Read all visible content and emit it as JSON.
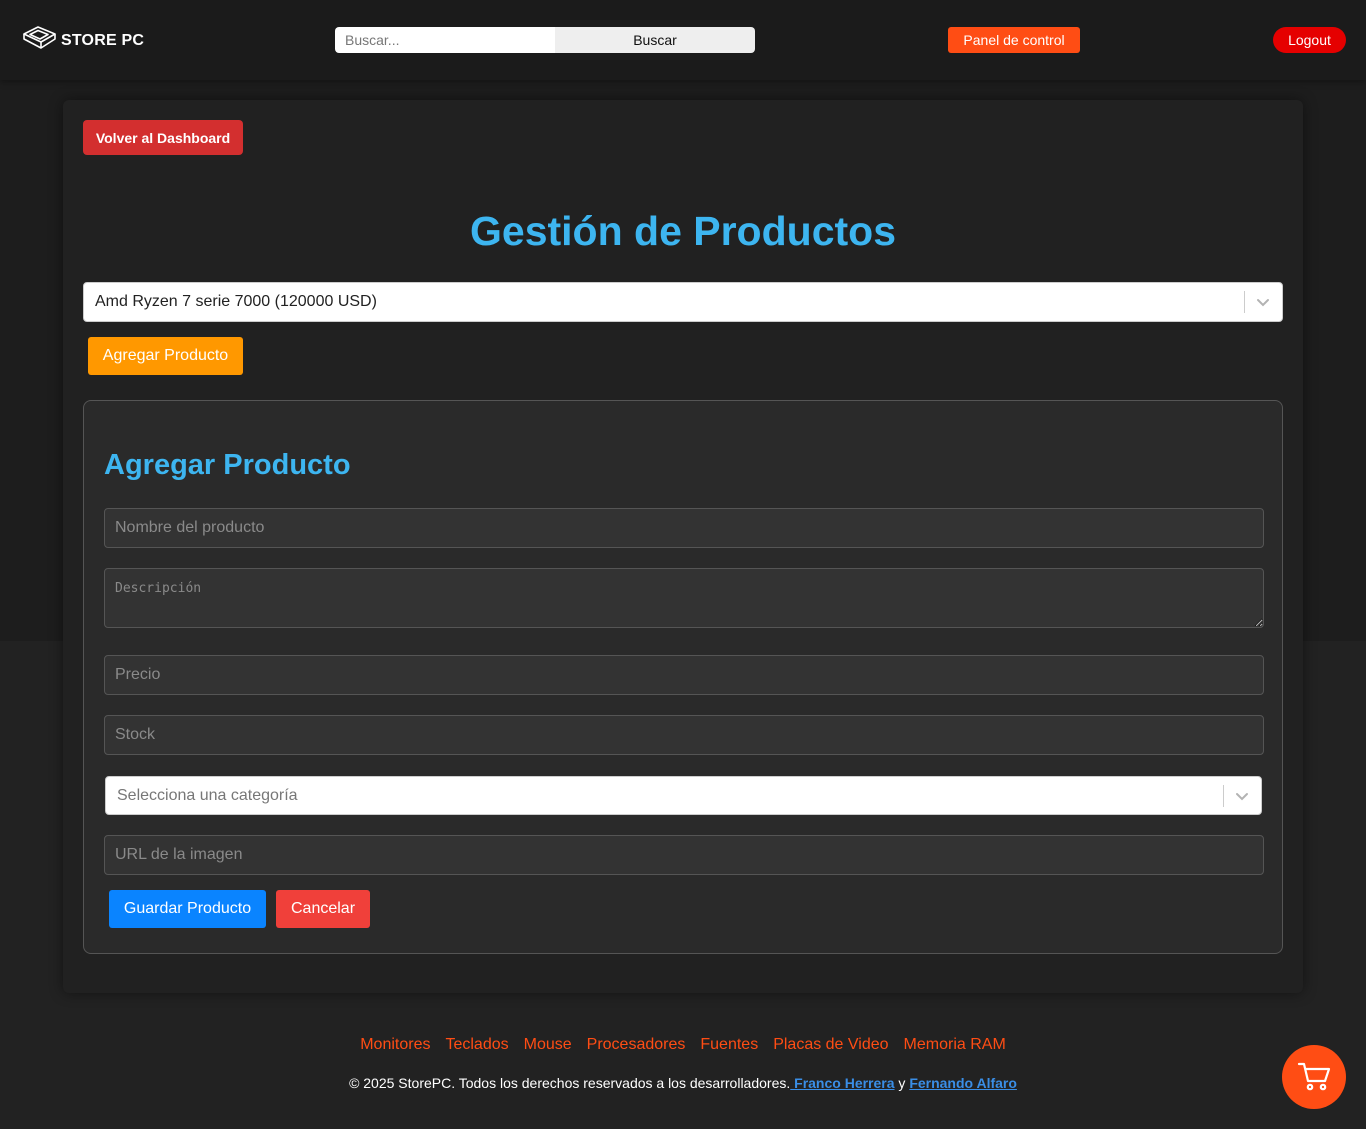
{
  "header": {
    "brand": "STORE PC",
    "search_placeholder": "Buscar...",
    "search_button": "Buscar",
    "panel_button": "Panel de control",
    "logout_button": "Logout"
  },
  "main": {
    "back_button": "Volver al Dashboard",
    "title": "Gestión de Productos",
    "product_select_value": "Amd Ryzen 7 serie 7000 (120000 USD)",
    "add_button": "Agregar Producto"
  },
  "form": {
    "title": "Agregar Producto",
    "name_placeholder": "Nombre del producto",
    "description_placeholder": "Descripción",
    "price_placeholder": "Precio",
    "stock_placeholder": "Stock",
    "category_placeholder": "Selecciona una categoría",
    "image_url_placeholder": "URL de la imagen",
    "save_button": "Guardar Producto",
    "cancel_button": "Cancelar"
  },
  "footer": {
    "links": [
      "Monitores",
      "Teclados",
      "Mouse",
      "Procesadores",
      "Fuentes",
      "Placas de Video",
      "Memoria RAM"
    ],
    "copyright_text": "© 2025 StorePC. Todos los derechos reservados a los desarrolladores.",
    "author1": " Franco Herrera",
    "connector": " y ",
    "author2": "Fernando Alfaro"
  },
  "icons": {
    "logo": "keyboard-key-icon",
    "select_arrow": "chevron-down-icon",
    "cart": "shopping-cart-icon"
  },
  "colors": {
    "accent_orange": "#ff4d14",
    "title_blue": "#3db5f0",
    "logout_red": "#e50000",
    "back_red": "#d32f2f",
    "add_orange": "#ff9800",
    "save_blue": "#0a84ff",
    "cancel_red": "#f0403a",
    "link_blue": "#3a8ee6"
  }
}
